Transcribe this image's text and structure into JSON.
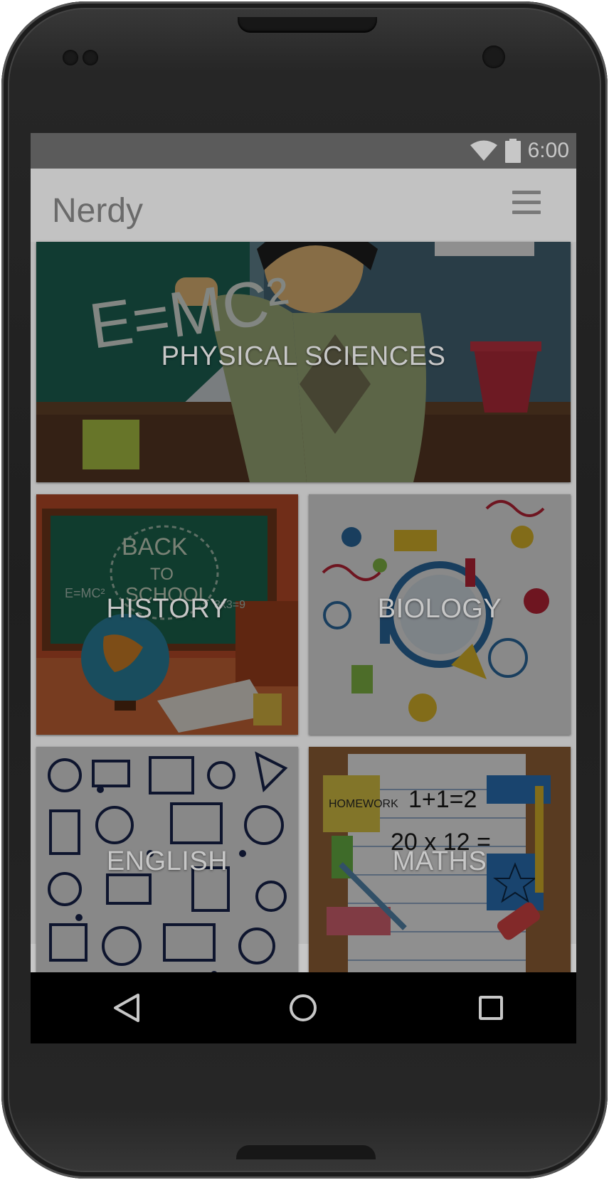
{
  "status_bar": {
    "time": "6:00",
    "icons": [
      "wifi-icon",
      "battery-icon"
    ],
    "color": "#757575"
  },
  "app_bar": {
    "title": "Nerdy",
    "menu_icon": "hamburger-menu-icon"
  },
  "subjects": [
    {
      "id": "physical-sciences",
      "label": "PHYSICAL SCIENCES"
    },
    {
      "id": "history",
      "label": "HISTORY"
    },
    {
      "id": "biology",
      "label": "BIOLOGY"
    },
    {
      "id": "english",
      "label": "ENGLISH"
    },
    {
      "id": "maths",
      "label": "MATHS"
    }
  ],
  "tile_artwork_text": {
    "physics_formula": "E=MC²",
    "history_board_1": "BACK",
    "history_board_2": "TO",
    "history_board_3": "SCHOOL",
    "history_formula": "E=MC²",
    "history_math": "3x3=9",
    "maths_note": "HOMEWORK",
    "maths_eq_1": "1+1=2",
    "maths_eq_2": "20 x 12 ="
  },
  "nav_bar": {
    "back_icon": "back-triangle-icon",
    "home_icon": "home-circle-icon",
    "recents_icon": "recents-square-icon"
  }
}
